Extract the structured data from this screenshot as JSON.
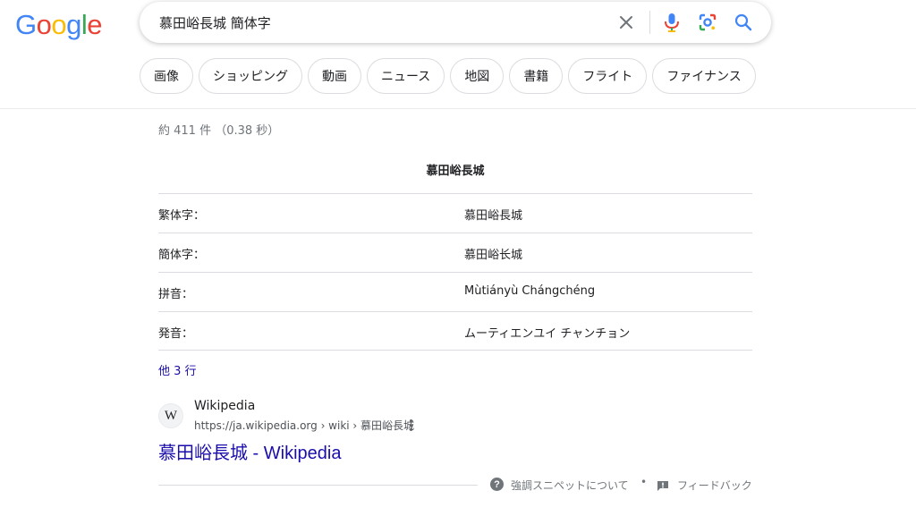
{
  "logo": {
    "letters": [
      "G",
      "o",
      "o",
      "g",
      "l",
      "e"
    ],
    "colors": [
      "#4285F4",
      "#EA4335",
      "#FBBC05",
      "#4285F4",
      "#34A853",
      "#EA4335"
    ]
  },
  "search": {
    "query": "慕田峪長城 簡体字",
    "icons": [
      "clear-icon",
      "microphone-icon",
      "lens-icon",
      "search-icon"
    ]
  },
  "chips": [
    "画像",
    "ショッピング",
    "動画",
    "ニュース",
    "地図",
    "書籍",
    "フライト",
    "ファイナンス"
  ],
  "stats": "約 411 件 （0.38 秒）",
  "snippet": {
    "title": "慕田峪長城",
    "rows": [
      {
        "key": "繁体字：",
        "value": "慕田峪長城"
      },
      {
        "key": "簡体字：",
        "value": "慕田峪长城"
      },
      {
        "key": "拼音：",
        "value": "Mùtiányù Chángchéng"
      },
      {
        "key": "発音：",
        "value": "ムーティエンユイ チャンチョン"
      }
    ],
    "more": "他 3 行"
  },
  "result": {
    "icon_letter": "W",
    "site": "Wikipedia",
    "url": "https://ja.wikipedia.org › wiki › 慕田峪長城",
    "title": "慕田峪長城 - Wikipedia"
  },
  "footer": {
    "about": "強調スニペットについて",
    "separator": "•",
    "feedback": "フィードバック"
  },
  "colors": {
    "link": "#1a0dab",
    "muted": "#70757a",
    "border": "#dadce0"
  }
}
